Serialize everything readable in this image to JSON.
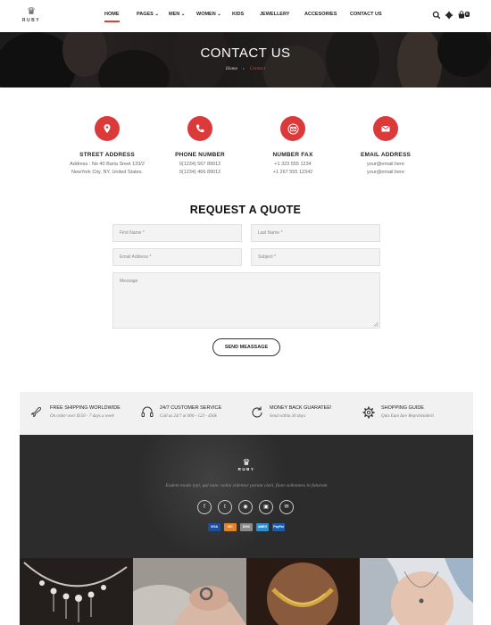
{
  "header": {
    "logo_text": "RUBY",
    "nav": [
      {
        "label": "HOME",
        "active": true
      },
      {
        "label": "PAGES"
      },
      {
        "label": "MEN"
      },
      {
        "label": "WOMEN"
      },
      {
        "label": "KIDS"
      },
      {
        "label": "JEWELLERY"
      },
      {
        "label": "ACCESORIES"
      },
      {
        "label": "CONTACT US"
      }
    ],
    "icons": [
      "search-icon",
      "gear-icon",
      "cart-icon"
    ],
    "cart_count": "0"
  },
  "hero": {
    "title": "CONTACT US",
    "breadcrumb": {
      "home": "Home",
      "separator": "›",
      "current": "Contact"
    }
  },
  "contact": [
    {
      "icon": "map-pin-icon",
      "title": "STREET ADDRESS",
      "lines": [
        "Address : No 40 Baria Sreet 133/2",
        "NewYork City, NY, United States."
      ]
    },
    {
      "icon": "phone-icon",
      "title": "PHONE NUMBER",
      "lines": [
        "0(1234) 567 89012",
        "0(1234) 466 89012"
      ]
    },
    {
      "icon": "envelope-open-icon",
      "title": "NUMBER FAX",
      "lines": [
        "+1 323 555 1234",
        "+1 267 555 12342"
      ]
    },
    {
      "icon": "envelope-icon",
      "title": "EMAIL ADDRESS",
      "lines": [
        "your@email.here",
        "your@email.here"
      ]
    }
  ],
  "quote": {
    "title": "REQUEST A QUOTE",
    "first_name_placeholder": "First Name *",
    "last_name_placeholder": "Last Name *",
    "email_placeholder": "Email Address *",
    "subject_placeholder": "Subject *",
    "message_placeholder": "Message",
    "send_label": "SEND MEASSAGE"
  },
  "features": [
    {
      "icon": "airplane-icon",
      "title": "FREE SHIPPING WORLDWIDE",
      "sub": "On order over $150 - 7 days a week"
    },
    {
      "icon": "headset-icon",
      "title": "24/7 CUSTOMER SERVICE",
      "sub": "Call us 24/7 at 000 - 123 - 456k"
    },
    {
      "icon": "refresh-icon",
      "title": "MONEY BACK GUARATEE!",
      "sub": "Send within 30 days"
    },
    {
      "icon": "gear-icon",
      "title": "SHOPPING GUIDE",
      "sub": "Quis Eum Iure Reprehenderit"
    }
  ],
  "footer": {
    "logo_text": "RUBY",
    "tagline": "Eodem modo typi, qui nunc nobis videntur parum clari, fiant sollemnes in futurum",
    "socials": [
      {
        "icon": "facebook-icon",
        "glyph": "f"
      },
      {
        "icon": "twitter-icon",
        "glyph": "t"
      },
      {
        "icon": "dribbble-icon",
        "glyph": "◉"
      },
      {
        "icon": "instagram-icon",
        "glyph": "▣"
      },
      {
        "icon": "email-icon",
        "glyph": "✉"
      }
    ],
    "payments": [
      {
        "name": "VISA",
        "color": "#1a4fa0"
      },
      {
        "name": "MC",
        "color": "#e2842a"
      },
      {
        "name": "DISC",
        "color": "#8a8a8a"
      },
      {
        "name": "AMEX",
        "color": "#2b8fd0"
      },
      {
        "name": "PayPal",
        "color": "#1e5ca8"
      }
    ]
  },
  "colors": {
    "accent": "#dc3a3a",
    "dark": "#2c2c2c",
    "features_bg": "#f1f1f1"
  }
}
